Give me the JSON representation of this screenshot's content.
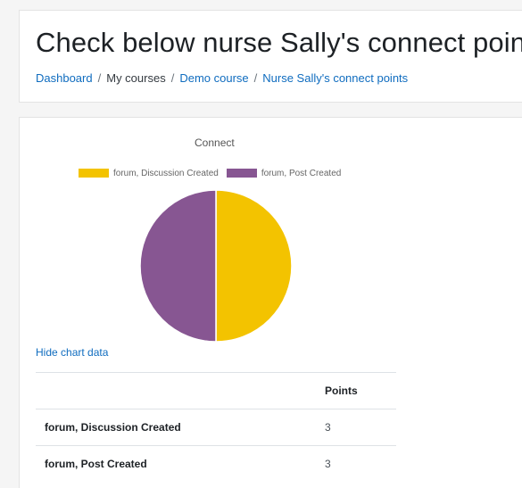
{
  "header": {
    "title": "Check below nurse Sally's connect points",
    "breadcrumb": {
      "dashboard": "Dashboard",
      "my_courses": "My courses",
      "demo_course": "Demo course",
      "current": "Nurse Sally's connect points",
      "separator": "/"
    }
  },
  "chart_data": {
    "type": "pie",
    "title": "Connect",
    "categories": [
      "forum, Discussion Created",
      "forum, Post Created"
    ],
    "series": [
      {
        "name": "Points",
        "values": [
          3,
          3
        ]
      }
    ],
    "colors": [
      "#f3c300",
      "#875692"
    ],
    "legend": "top"
  },
  "chart_toggle": {
    "label": "Hide chart data"
  },
  "table": {
    "header": [
      "",
      "Points"
    ],
    "rows": [
      {
        "label": "forum, Discussion Created",
        "value": "3"
      },
      {
        "label": "forum, Post Created",
        "value": "3"
      }
    ]
  }
}
